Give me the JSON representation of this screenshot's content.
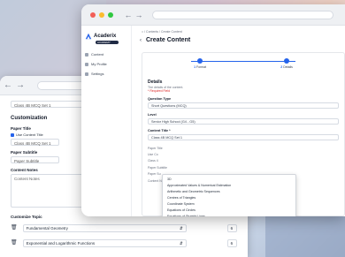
{
  "colors": {
    "accent": "#2563eb",
    "dot_red": "#f25f58",
    "dot_yellow": "#fbbc2e",
    "dot_green": "#30c840"
  },
  "back_window": {
    "field_top": "Class 4B MCQ Set 1",
    "customization_heading": "Customization",
    "paper_title_label": "Paper Title",
    "use_content_title_label": "Use Content Title",
    "paper_title_value": "Class 4B MCQ Set 1",
    "paper_subtitle_label": "Paper Subtitle",
    "paper_subtitle_placeholder": "Paper Subtitle",
    "content_notes_label": "Content Notes",
    "content_notes_placeholder": "Content Notes",
    "customize_topic_label": "Customize Topic",
    "topics": [
      {
        "name": "Fundamental Geometry",
        "count": "6"
      },
      {
        "name": "Exponential and Logarithmic Functions",
        "count": "6"
      }
    ]
  },
  "front_window": {
    "logo_text": "Acaderix",
    "logo_sub": "ACADEMY",
    "sidebar": [
      {
        "label": "Content"
      },
      {
        "label": "My Profile"
      },
      {
        "label": "Settings"
      }
    ],
    "breadcrumb": "Contents  /  Create Content",
    "page_title": "Create Content",
    "steps": [
      {
        "num": "1",
        "label": "Format"
      },
      {
        "num": "2",
        "label": "Details"
      }
    ],
    "details_heading": "Details",
    "details_sub": "The details of the content.",
    "required_note": "* Required Field",
    "question_type_label": "Question Type",
    "question_type_value": "Short Questions (MCQ)",
    "level_label": "Level",
    "level_value": "Senior High School (G4 - G5)",
    "content_title_label": "Content Title *",
    "content_title_value": "Class 4B MCQ Set 1",
    "behind_labels": [
      "Paper Title",
      "Use Co",
      "Class 4",
      "Paper Subtitle",
      "Paper Su",
      "Content Not"
    ],
    "dropdown_options": [
      "3D",
      "Approximated Values & Numerical Estimation",
      "Arithmetic and Geometric Sequences",
      "Centres of Triangles",
      "Coordinate System",
      "Equations of Circles",
      "Equations of Straight Lines",
      "Errors in Measurement",
      "Exponential and Logarithmic Functions",
      "Fundamental Algebra",
      "Fundamental Geometry"
    ]
  }
}
